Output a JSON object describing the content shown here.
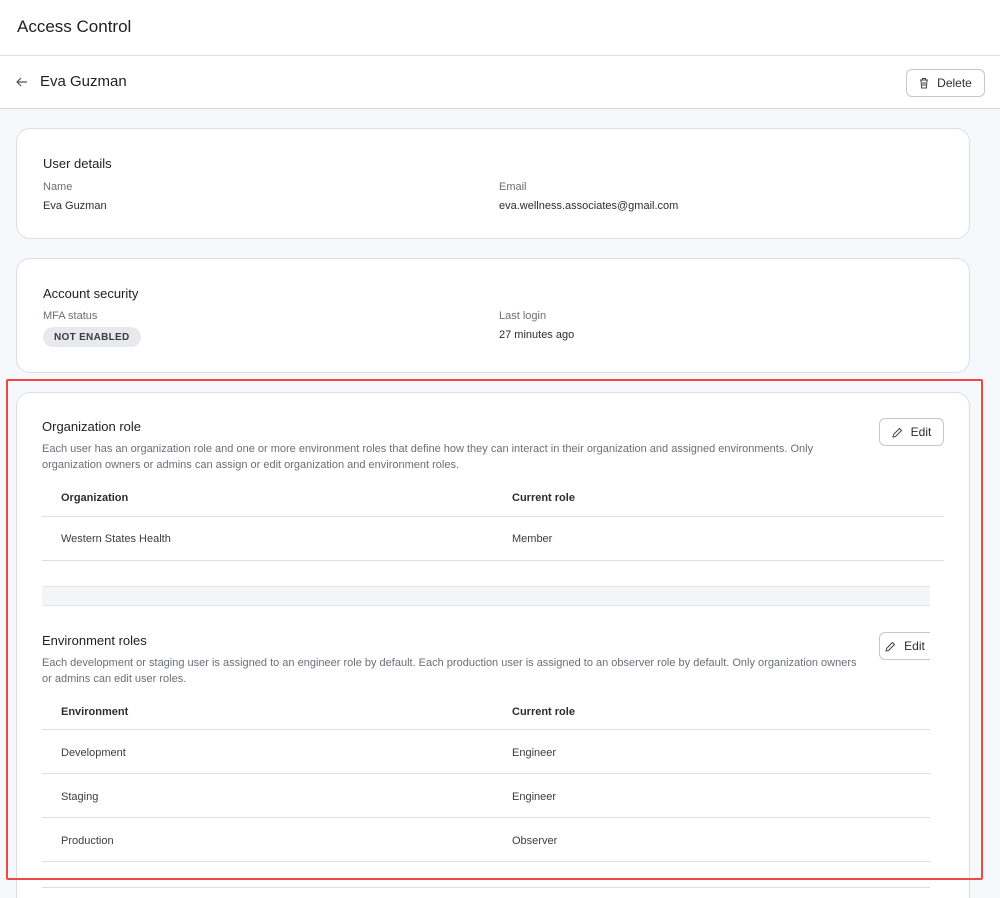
{
  "app": {
    "title": "Access Control"
  },
  "header": {
    "user_name": "Eva Guzman",
    "delete_label": "Delete"
  },
  "user_details": {
    "title": "User details",
    "name_label": "Name",
    "name_value": "Eva Guzman",
    "email_label": "Email",
    "email_value": "eva.wellness.associates@gmail.com"
  },
  "account_security": {
    "title": "Account security",
    "mfa_label": "MFA status",
    "mfa_value": "NOT ENABLED",
    "last_login_label": "Last login",
    "last_login_value": "27 minutes ago"
  },
  "organization_role": {
    "title": "Organization role",
    "description": "Each user has an organization role and one or more environment roles that define how they can interact in their organization and assigned environments. Only organization owners or admins can assign or edit organization and environment roles.",
    "edit_label": "Edit",
    "columns": [
      "Organization",
      "Current role"
    ],
    "rows": [
      {
        "name": "Western States Health",
        "role": "Member"
      }
    ]
  },
  "environment_roles": {
    "title": "Environment roles",
    "description": "Each development or staging user is assigned to an engineer role by default. Each production user is assigned to an observer role by default. Only organization owners or admins can edit user roles.",
    "edit_label": "Edit",
    "columns": [
      "Environment",
      "Current role"
    ],
    "rows": [
      {
        "name": "Development",
        "role": "Engineer"
      },
      {
        "name": "Staging",
        "role": "Engineer"
      },
      {
        "name": "Production",
        "role": "Observer"
      }
    ]
  },
  "colors": {
    "highlight": "#ee4a44",
    "background": "#f7f8fc",
    "card": "#ffffff"
  }
}
